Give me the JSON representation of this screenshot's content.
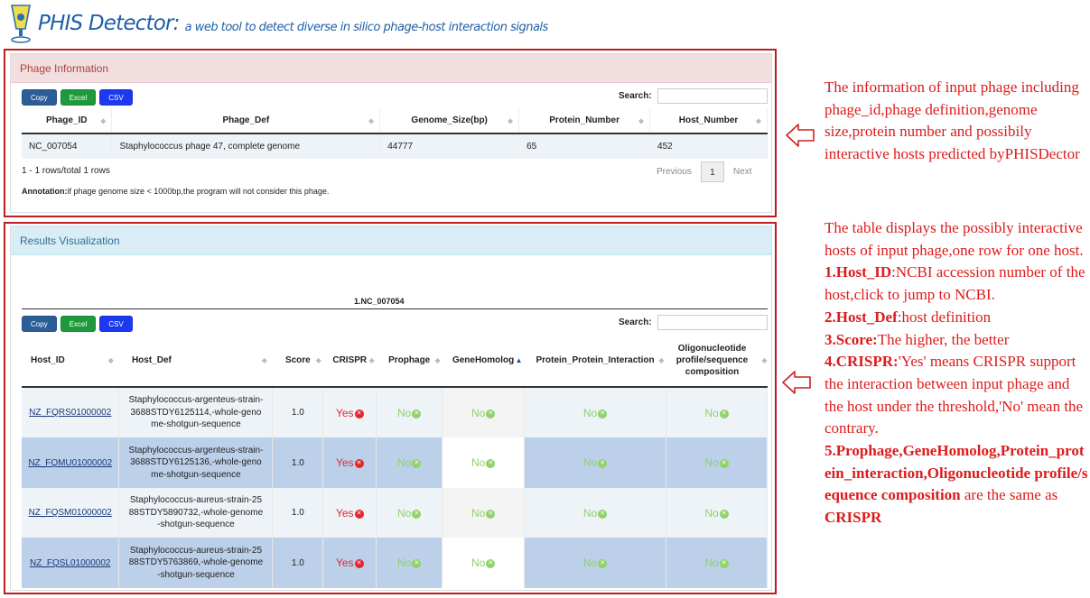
{
  "header": {
    "title": "PHIS Detector:",
    "subtitle": "a web tool to detect diverse in silico phage-host interaction signals"
  },
  "phage_panel": {
    "heading": "Phage Information",
    "buttons": [
      "Copy",
      "Excel",
      "CSV"
    ],
    "search_label": "Search:",
    "columns": [
      "Phage_ID",
      "Phage_Def",
      "Genome_Size(bp)",
      "Protein_Number",
      "Host_Number"
    ],
    "row": [
      "NC_007054",
      "Staphylococcus phage 47, complete genome",
      "44777",
      "65",
      "452"
    ],
    "rows_info": "1 - 1 rows/total 1 rows",
    "pager": {
      "previous": "Previous",
      "page": "1",
      "next": "Next"
    },
    "annotation_label": "Annotation:",
    "annotation_text": "if phage genome size < 1000bp,the program will not consider this phage."
  },
  "results_panel": {
    "heading": "Results Visualization",
    "viz_label": "1.NC_007054",
    "buttons": [
      "Copy",
      "Excel",
      "CSV"
    ],
    "search_label": "Search:",
    "columns": [
      "Host_ID",
      "Host_Def",
      "Score",
      "CRISPR",
      "Prophage",
      "GeneHomolog",
      "Protein_Protein_Interaction",
      "Oligonucleotide profile/sequence composition"
    ],
    "rows": [
      {
        "host_id": "NZ_FQRS01000002",
        "host_def": "Staphylococcus-argenteus-strain-3688STDY6125114,-whole-genome-shotgun-sequence",
        "score": "1.0",
        "crispr": "Yes",
        "prophage": "No",
        "genehomolog": "No",
        "ppi": "No",
        "oligo": "No"
      },
      {
        "host_id": "NZ_FQMU01000002",
        "host_def": "Staphylococcus-argenteus-strain-3688STDY6125136,-whole-genome-shotgun-sequence",
        "score": "1.0",
        "crispr": "Yes",
        "prophage": "No",
        "genehomolog": "No",
        "ppi": "No",
        "oligo": "No"
      },
      {
        "host_id": "NZ_FQSM01000002",
        "host_def": "Staphylococcus-aureus-strain-2588STDY5890732,-whole-genome-shotgun-sequence",
        "score": "1.0",
        "crispr": "Yes",
        "prophage": "No",
        "genehomolog": "No",
        "ppi": "No",
        "oligo": "No"
      },
      {
        "host_id": "NZ_FQSL01000002",
        "host_def": "Staphylococcus-aureus-strain-2588STDY5763869,-whole-genome-shotgun-sequence",
        "score": "1.0",
        "crispr": "Yes",
        "prophage": "No",
        "genehomolog": "No",
        "ppi": "No",
        "oligo": "No"
      }
    ]
  },
  "annotations": {
    "phage_note": "The information of input phage including phage_id,phage definition,genome size,protein number and possibily interactive hosts predicted byPHISDector",
    "results_intro": "The table displays the possibly interactive hosts of input phage,one row for one host.",
    "item1_label": "1.Host_ID",
    "item1_text": ":NCBI accession number of the host,click to jump to NCBI.",
    "item2_label": "2.Host_Def",
    "item2_text": ":host definition",
    "item3_label": "3.Score:",
    "item3_text": "The higher, the better",
    "item4_label": "4.CRISPR:",
    "item4_text": "'Yes' means CRISPR support the interaction between input phage and the host under the threshold,'No' mean the contrary.",
    "item5_label": "5.Prophage,GeneHomolog,Protein_protein_interaction,Oligonucleotide profile/sequence composition",
    "item5_text": " are the same as ",
    "item5_tail": "CRISPR"
  },
  "colors": {
    "accent_red": "#b8201f",
    "note_red": "#dd1b1b",
    "brand_blue": "#1f5fa8",
    "yes_red": "#e5242e",
    "no_green": "#8fd26a"
  },
  "icons": [
    "logo-icon",
    "sort-icon",
    "times-circle-icon",
    "hollow-arrow-left-icon"
  ]
}
